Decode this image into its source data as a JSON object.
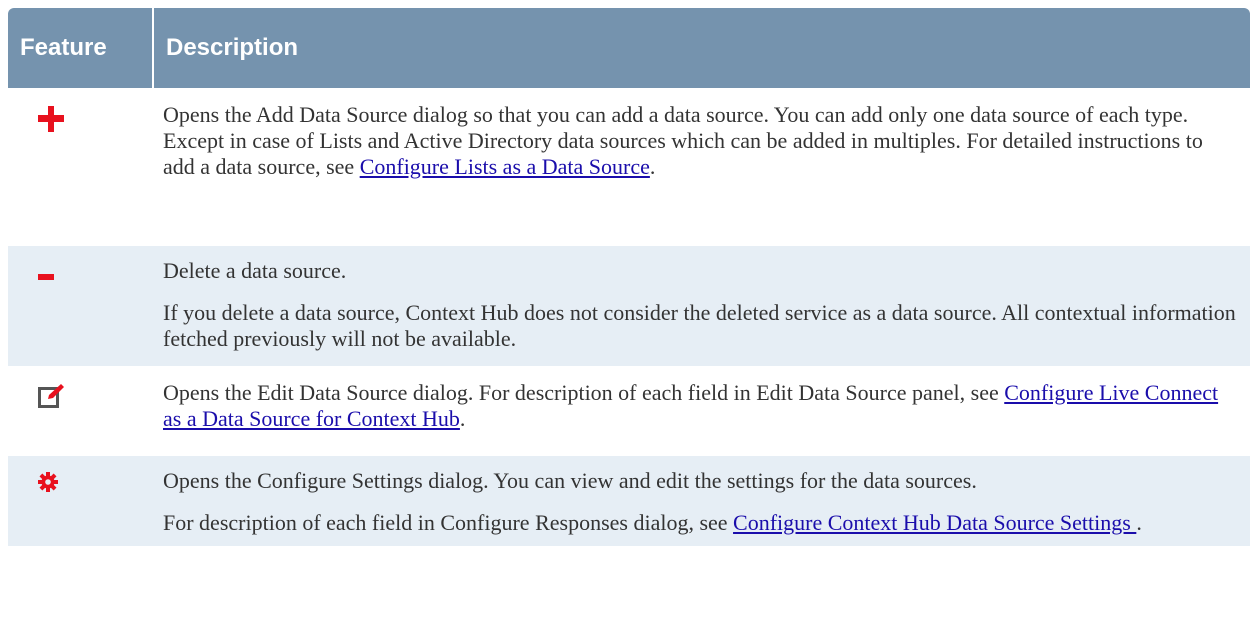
{
  "table": {
    "header": {
      "feature": "Feature",
      "description": "Description"
    },
    "rows": [
      {
        "icon": "add-icon",
        "text": "Opens the Add Data Source dialog so that you can add a data source. You can add only one data source of each type. Except in case of Lists and Active Directory data sources which can be added in multiples. For detailed instructions to add a data source, see ",
        "link": "Configure Lists as a Data Source",
        "after": "."
      },
      {
        "icon": "delete-icon",
        "p1": "Delete a data source.",
        "p2": "If you delete a data source, Context Hub does not consider the deleted service as a data source. All contextual information fetched previously will not be available."
      },
      {
        "icon": "edit-icon",
        "text": "Opens the Edit Data Source dialog. For description of each field in Edit Data Source panel, see ",
        "link": "Configure Live Connect as a Data Source for Context Hub",
        "after": "."
      },
      {
        "icon": "gear-icon",
        "p1": "Opens the Configure Settings dialog. You can view and edit the settings for the data sources.",
        "p2_text": "For description of each field in Configure Responses dialog, see ",
        "p2_link": "Configure Context Hub Data Source Settings ",
        "p2_after": "."
      }
    ]
  },
  "colors": {
    "header": "#7593ae",
    "row_alt": "#e6eef5",
    "icon_red": "#e8111e",
    "link": "#1a0dab"
  }
}
